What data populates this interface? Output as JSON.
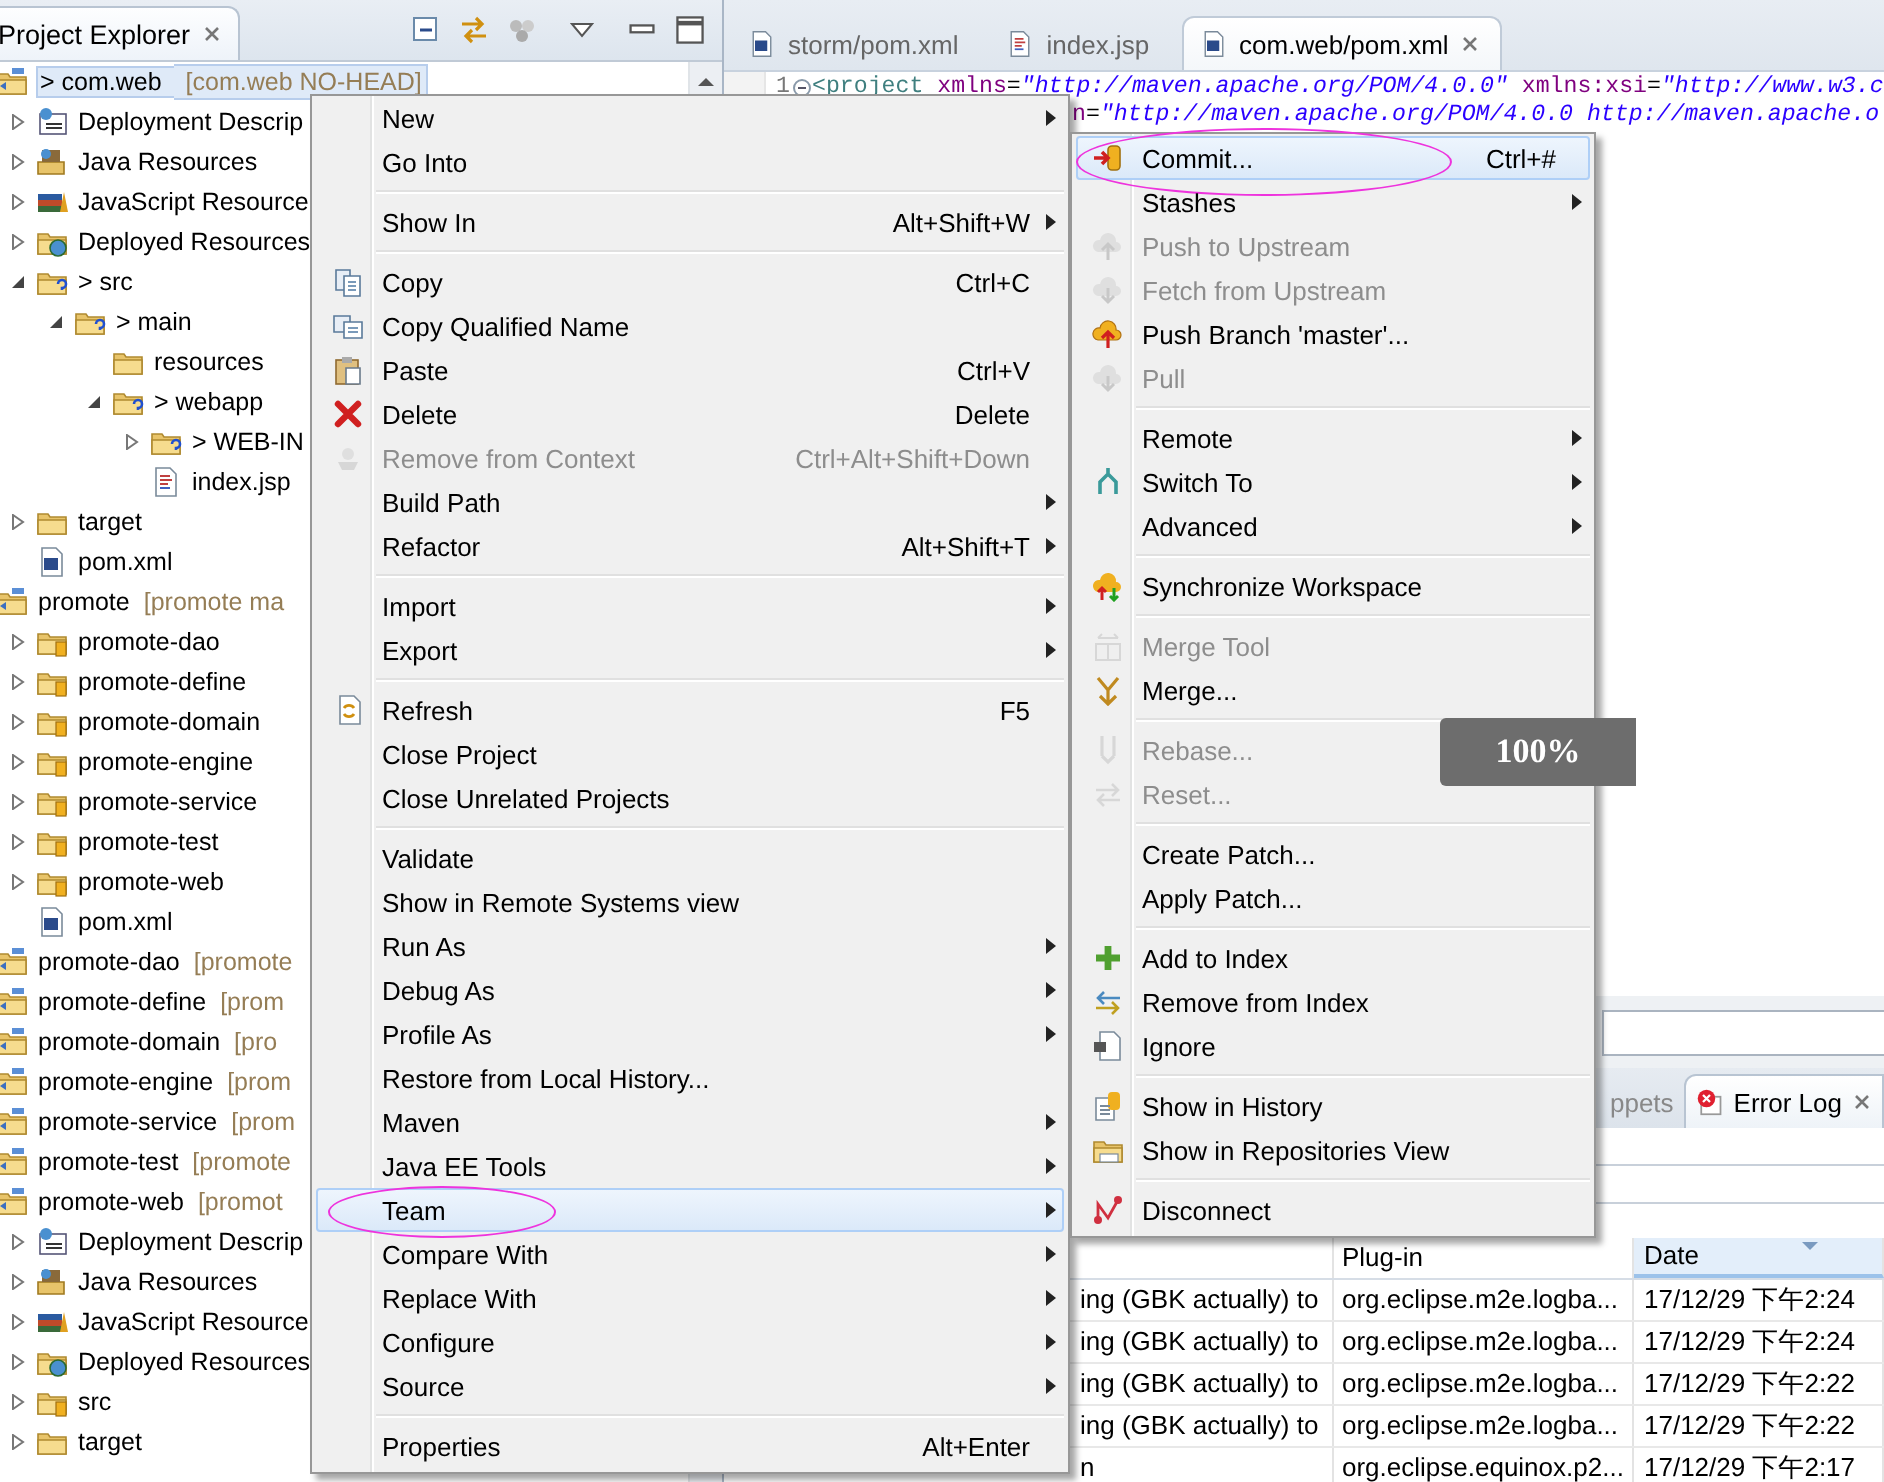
{
  "project_explorer": {
    "title": "Project Explorer",
    "selected": true,
    "tree": [
      {
        "label": "> com.web",
        "decoration": "[com.web NO-HEAD]",
        "kind": "project",
        "selected": true,
        "children": [
          {
            "label": "Deployment Descrip",
            "kind": "descriptor",
            "expanded": false,
            "selected": false
          },
          {
            "label": "Java Resources",
            "kind": "javares",
            "expanded": false,
            "selected": false
          },
          {
            "label": "JavaScript Resource",
            "kind": "jsres",
            "expanded": false,
            "selected": false
          },
          {
            "label": "Deployed Resources",
            "kind": "deployed",
            "expanded": false,
            "selected": false
          },
          {
            "label": "> src",
            "kind": "srcfolder",
            "expanded": true,
            "selected": false,
            "children": [
              {
                "label": "> main",
                "kind": "srcfolder",
                "expanded": true,
                "selected": false,
                "children": [
                  {
                    "label": "resources",
                    "kind": "folder",
                    "selected": false
                  },
                  {
                    "label": "> webapp",
                    "kind": "srcfolder",
                    "expanded": true,
                    "selected": false,
                    "children": [
                      {
                        "label": "> WEB-IN",
                        "kind": "srcfolder",
                        "expanded": false,
                        "selected": false
                      },
                      {
                        "label": "index.jsp",
                        "kind": "jsp",
                        "selected": false
                      }
                    ]
                  }
                ]
              }
            ]
          },
          {
            "label": "target",
            "kind": "folder",
            "expanded": false,
            "selected": false
          },
          {
            "label": "pom.xml",
            "kind": "pom",
            "selected": false
          }
        ]
      },
      {
        "label": "promote",
        "decoration": "[promote ma",
        "kind": "project",
        "selected": false,
        "children": [
          {
            "label": "promote-dao",
            "kind": "module",
            "expanded": false,
            "selected": false
          },
          {
            "label": "promote-define",
            "kind": "module",
            "expanded": false,
            "selected": false
          },
          {
            "label": "promote-domain",
            "kind": "module",
            "expanded": false,
            "selected": false
          },
          {
            "label": "promote-engine",
            "kind": "module",
            "expanded": false,
            "selected": false
          },
          {
            "label": "promote-service",
            "kind": "module",
            "expanded": false,
            "selected": false
          },
          {
            "label": "promote-test",
            "kind": "module",
            "expanded": false,
            "selected": false
          },
          {
            "label": "promote-web",
            "kind": "module",
            "expanded": false,
            "selected": false
          },
          {
            "label": "pom.xml",
            "kind": "pom",
            "selected": false
          }
        ]
      },
      {
        "label": "promote-dao",
        "decoration": "[promote",
        "kind": "project",
        "selected": false
      },
      {
        "label": "promote-define",
        "decoration": "[prom",
        "kind": "project",
        "selected": false
      },
      {
        "label": "promote-domain",
        "decoration": "[pro",
        "kind": "project",
        "selected": false
      },
      {
        "label": "promote-engine",
        "decoration": "[prom",
        "kind": "project",
        "selected": false
      },
      {
        "label": "promote-service",
        "decoration": "[prom",
        "kind": "project",
        "selected": false
      },
      {
        "label": "promote-test",
        "decoration": "[promote",
        "kind": "project",
        "selected": false
      },
      {
        "label": "promote-web",
        "decoration": "[promot",
        "kind": "project",
        "selected": false,
        "children": [
          {
            "label": "Deployment Descrip",
            "kind": "descriptor",
            "expanded": false,
            "selected": false
          },
          {
            "label": "Java Resources",
            "kind": "javares",
            "expanded": false,
            "selected": false
          },
          {
            "label": "JavaScript Resource",
            "kind": "jsres",
            "expanded": false,
            "selected": false
          },
          {
            "label": "Deployed Resources",
            "kind": "deployed",
            "expanded": false,
            "selected": false
          },
          {
            "label": "src",
            "kind": "module",
            "expanded": false,
            "selected": false
          },
          {
            "label": "target",
            "kind": "folder",
            "expanded": false,
            "selected": false
          }
        ]
      }
    ]
  },
  "editor": {
    "tabs": [
      {
        "label": "storm/pom.xml",
        "kind": "pom",
        "selected": false
      },
      {
        "label": "index.jsp",
        "kind": "jsp",
        "selected": false
      },
      {
        "label": "com.web/pom.xml",
        "kind": "pom",
        "selected": true
      }
    ],
    "lines": [
      {
        "number": "1",
        "tokens": [
          {
            "text": "<project",
            "kind": "tag"
          },
          {
            "text": " xmlns",
            "kind": "attr"
          },
          {
            "text": "=",
            "kind": "plain"
          },
          {
            "text": "\"http://maven.apache.org/POM/4.0.0\"",
            "kind": "value"
          },
          {
            "text": " xmlns:xsi",
            "kind": "attr"
          },
          {
            "text": "=",
            "kind": "plain"
          },
          {
            "text": "\"http://www.w3.c",
            "kind": "value"
          }
        ]
      },
      {
        "tokens": [
          {
            "text": "n",
            "kind": "attr"
          },
          {
            "text": "=",
            "kind": "plain"
          },
          {
            "text": "\"http://maven.apache.org/POM/4.0.0 http://maven.apache.o",
            "kind": "value"
          }
        ]
      }
    ]
  },
  "bottom_panel": {
    "tabs": [
      {
        "label": "ppets",
        "selected": false
      },
      {
        "label": "Error Log",
        "selected": true
      }
    ],
    "columns": [
      {
        "sorted": false
      },
      {
        "label": "Plug-in",
        "sorted": false
      },
      {
        "label": "Date",
        "sorted": true
      }
    ],
    "rows": [
      [
        "ing (GBK actually) to",
        "org.eclipse.m2e.logba...",
        "17/12/29 下午2:24"
      ],
      [
        "ing (GBK actually) to",
        "org.eclipse.m2e.logba...",
        "17/12/29 下午2:24"
      ],
      [
        "ing (GBK actually) to",
        "org.eclipse.m2e.logba...",
        "17/12/29 下午2:22"
      ],
      [
        "ing (GBK actually) to",
        "org.eclipse.m2e.logba...",
        "17/12/29 下午2:22"
      ],
      [
        "n",
        "org.eclipse.equinox.p2...",
        "17/12/29 下午2:17"
      ]
    ]
  },
  "context_menu": {
    "items": [
      {
        "kind": "item",
        "label": "New",
        "submenu": true,
        "selected": false
      },
      {
        "kind": "item",
        "label": "Go Into",
        "selected": false
      },
      {
        "kind": "separator"
      },
      {
        "kind": "item",
        "label": "Show In",
        "shortcut": "Alt+Shift+W",
        "submenu": true,
        "selected": false
      },
      {
        "kind": "separator"
      },
      {
        "kind": "copy",
        "label": "Copy",
        "shortcut": "Ctrl+C",
        "selected": false
      },
      {
        "kind": "copyq",
        "label": "Copy Qualified Name",
        "selected": false
      },
      {
        "kind": "paste",
        "label": "Paste",
        "shortcut": "Ctrl+V",
        "selected": false
      },
      {
        "kind": "delete",
        "label": "Delete",
        "shortcut": "Delete",
        "selected": false
      },
      {
        "kind": "context",
        "label": "Remove from Context",
        "shortcut": "Ctrl+Alt+Shift+Down",
        "disabled": true,
        "selected": false
      },
      {
        "kind": "item",
        "label": "Build Path",
        "submenu": true,
        "selected": false
      },
      {
        "kind": "item",
        "label": "Refactor",
        "shortcut": "Alt+Shift+T",
        "submenu": true,
        "selected": false
      },
      {
        "kind": "separator"
      },
      {
        "kind": "item",
        "label": "Import",
        "submenu": true,
        "selected": false
      },
      {
        "kind": "item",
        "label": "Export",
        "submenu": true,
        "selected": false
      },
      {
        "kind": "separator"
      },
      {
        "kind": "refresh",
        "label": "Refresh",
        "shortcut": "F5",
        "selected": false
      },
      {
        "kind": "item",
        "label": "Close Project",
        "selected": false
      },
      {
        "kind": "item",
        "label": "Close Unrelated Projects",
        "selected": false
      },
      {
        "kind": "separator"
      },
      {
        "kind": "item",
        "label": "Validate",
        "selected": false
      },
      {
        "kind": "item",
        "label": "Show in Remote Systems view",
        "selected": false
      },
      {
        "kind": "item",
        "label": "Run As",
        "submenu": true,
        "selected": false
      },
      {
        "kind": "item",
        "label": "Debug As",
        "submenu": true,
        "selected": false
      },
      {
        "kind": "item",
        "label": "Profile As",
        "submenu": true,
        "selected": false
      },
      {
        "kind": "item",
        "label": "Restore from Local History...",
        "selected": false
      },
      {
        "kind": "item",
        "label": "Maven",
        "submenu": true,
        "selected": false
      },
      {
        "kind": "item",
        "label": "Java EE Tools",
        "submenu": true,
        "selected": false
      },
      {
        "kind": "item",
        "label": "Team",
        "submenu": true,
        "selected": true,
        "circled": true
      },
      {
        "kind": "item",
        "label": "Compare With",
        "submenu": true,
        "selected": false
      },
      {
        "kind": "item",
        "label": "Replace With",
        "submenu": true,
        "selected": false
      },
      {
        "kind": "item",
        "label": "Configure",
        "submenu": true,
        "selected": false
      },
      {
        "kind": "item",
        "label": "Source",
        "submenu": true,
        "selected": false
      },
      {
        "kind": "separator"
      },
      {
        "kind": "item",
        "label": "Properties",
        "shortcut": "Alt+Enter",
        "selected": false
      }
    ]
  },
  "team_menu": {
    "items": [
      {
        "kind": "commit",
        "label": "Commit...",
        "shortcut": "Ctrl+#",
        "selected": true,
        "circled": true
      },
      {
        "kind": "item",
        "label": "Stashes",
        "submenu": true,
        "selected": false
      },
      {
        "kind": "cloudup",
        "label": "Push to Upstream",
        "disabled": true,
        "selected": false
      },
      {
        "kind": "clouddown",
        "label": "Fetch from Upstream",
        "disabled": true,
        "selected": false
      },
      {
        "kind": "pushbranch",
        "label": "Push Branch 'master'...",
        "selected": false
      },
      {
        "kind": "clouddown",
        "label": "Pull",
        "disabled": true,
        "selected": false
      },
      {
        "kind": "separator"
      },
      {
        "kind": "item",
        "label": "Remote",
        "submenu": true,
        "selected": false
      },
      {
        "kind": "switch",
        "label": "Switch To",
        "submenu": true,
        "selected": false
      },
      {
        "kind": "item",
        "label": "Advanced",
        "submenu": true,
        "selected": false
      },
      {
        "kind": "separator"
      },
      {
        "kind": "sync",
        "label": "Synchronize Workspace",
        "selected": false
      },
      {
        "kind": "separator"
      },
      {
        "kind": "mergetool",
        "label": "Merge Tool",
        "disabled": true,
        "selected": false
      },
      {
        "kind": "merge",
        "label": "Merge...",
        "selected": false
      },
      {
        "kind": "separator"
      },
      {
        "kind": "rebase",
        "label": "Rebase...",
        "disabled": true,
        "selected": false
      },
      {
        "kind": "reset",
        "label": "Reset...",
        "disabled": true,
        "selected": false
      },
      {
        "kind": "separator"
      },
      {
        "kind": "item",
        "label": "Create Patch...",
        "selected": false
      },
      {
        "kind": "item",
        "label": "Apply Patch...",
        "selected": false
      },
      {
        "kind": "separator"
      },
      {
        "kind": "add",
        "label": "Add to Index",
        "selected": false
      },
      {
        "kind": "removeindex",
        "label": "Remove from Index",
        "selected": false
      },
      {
        "kind": "ignore",
        "label": "Ignore",
        "selected": false
      },
      {
        "kind": "separator"
      },
      {
        "kind": "history",
        "label": "Show in History",
        "selected": false
      },
      {
        "kind": "repos",
        "label": "Show in Repositories View",
        "selected": false
      },
      {
        "kind": "separator"
      },
      {
        "kind": "disconnect",
        "label": "Disconnect",
        "selected": false
      }
    ]
  },
  "zoom_indicator": "100%"
}
